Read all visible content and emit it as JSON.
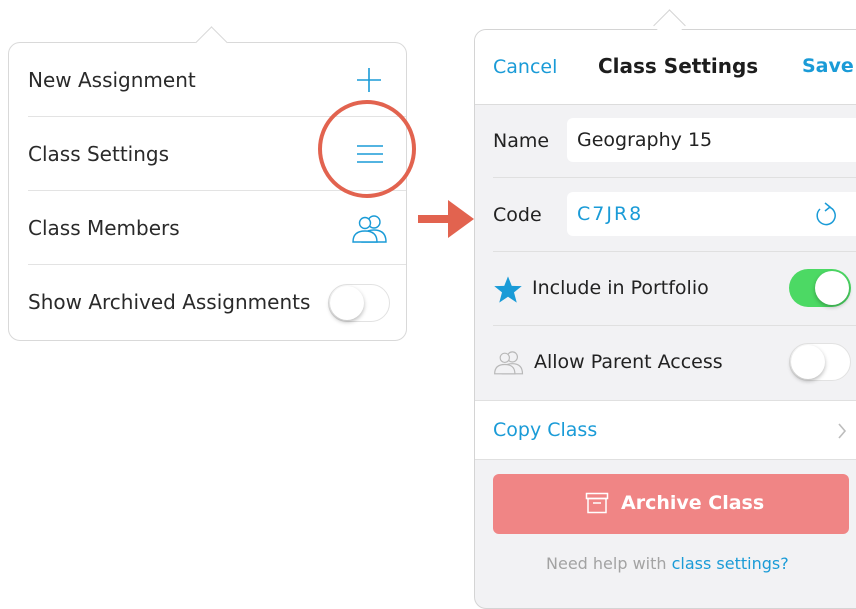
{
  "menu": {
    "items": [
      {
        "label": "New Assignment",
        "icon": "plus-icon"
      },
      {
        "label": "Class Settings",
        "icon": "hamburger-icon"
      },
      {
        "label": "Class Members",
        "icon": "people-icon"
      },
      {
        "label": "Show Archived Assignments",
        "toggle": false
      }
    ]
  },
  "class_settings": {
    "nav": {
      "cancel": "Cancel",
      "title": "Class Settings",
      "save": "Save"
    },
    "name_label": "Name",
    "name_value": "Geography 15",
    "code_label": "Code",
    "code_value": "C7JR8",
    "include_portfolio": {
      "label": "Include in Portfolio",
      "enabled": true
    },
    "parent_access": {
      "label": "Allow Parent Access",
      "enabled": false
    },
    "copy_class": "Copy Class",
    "archive_button": "Archive Class",
    "help_prefix": "Need help with ",
    "help_link": "class settings?"
  },
  "colors": {
    "accent": "#1a9bd7",
    "toggle_on": "#4cd964",
    "archive": "#f08585",
    "annotation": "#e2634f"
  }
}
